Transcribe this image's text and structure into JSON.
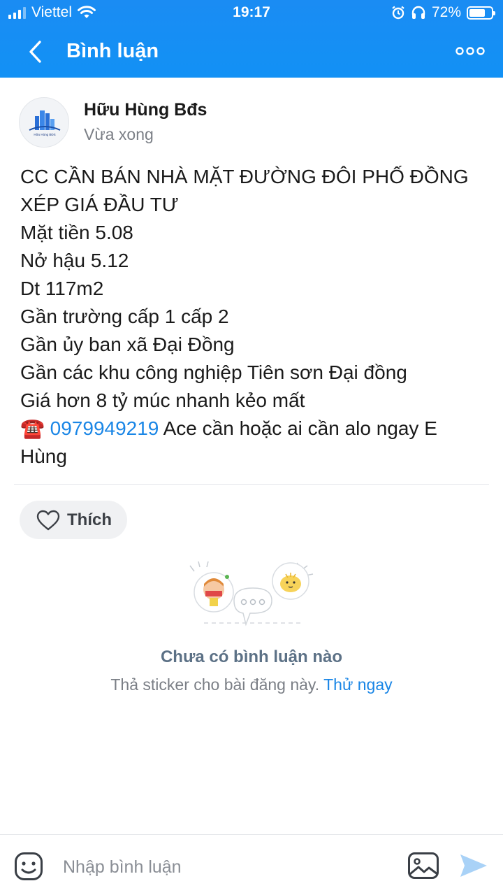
{
  "status_bar": {
    "carrier": "Viettel",
    "time": "19:17",
    "battery_text": "72%",
    "battery_level": 0.72
  },
  "nav": {
    "title": "Bình luận"
  },
  "post": {
    "author": "Hữu Hùng Bđs",
    "time": "Vừa xong",
    "avatar_caption": "Hữu Hùng BĐS",
    "lines": [
      "CC CẦN BÁN NHÀ MẶT ĐƯỜNG ĐÔI PHỐ ĐỒNG",
      "XÉP GIÁ ĐẦU TƯ",
      "Mặt tiền 5.08",
      "Nở hậu 5.12",
      "Dt 117m2",
      "Gần trường cấp 1 cấp 2",
      "Gần ủy ban xã Đại Đồng",
      "Gần các khu công nghiệp Tiên sơn Đại đồng",
      "Giá hơn 8 tỷ múc nhanh kẻo mất"
    ],
    "phone_emoji": "☎️",
    "phone": "0979949219",
    "contact_text": " Ace cần hoặc ai cần alo ngay E Hùng"
  },
  "like_button": {
    "label": "Thích"
  },
  "empty_state": {
    "title": "Chưa có bình luận nào",
    "subtitle": "Thả sticker cho bài đăng này.",
    "action": "Thử ngay"
  },
  "input_bar": {
    "placeholder": "Nhập bình luận"
  },
  "colors": {
    "header": "#1291f5",
    "link": "#1a86e6",
    "send": "#a9d2f7"
  }
}
